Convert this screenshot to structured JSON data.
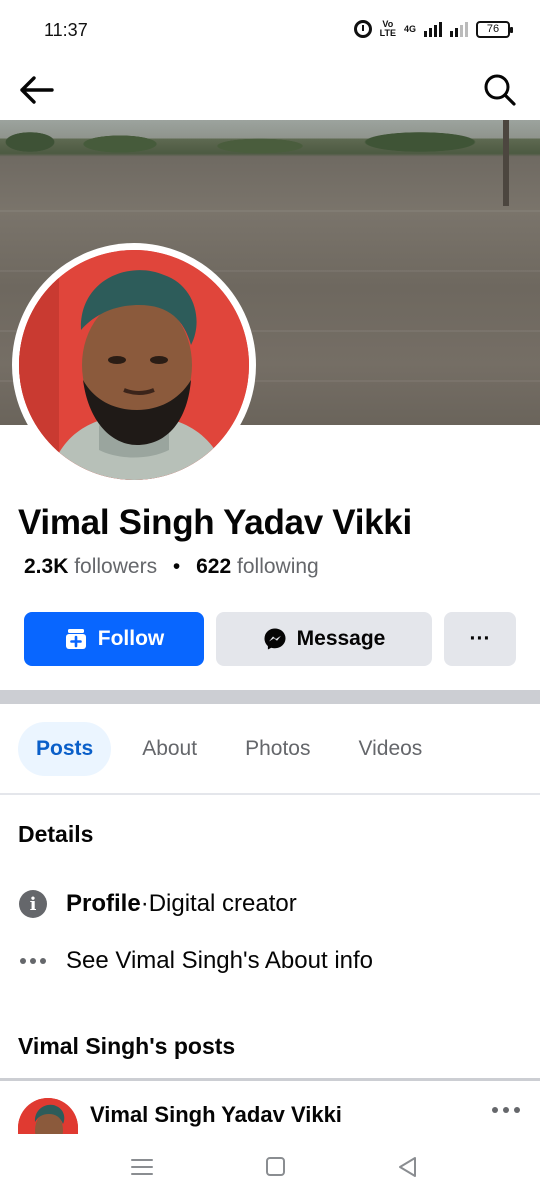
{
  "status_bar": {
    "time": "11:37",
    "volte_line1": "Vo",
    "volte_line2": "LTE",
    "network": "4G",
    "battery": "76"
  },
  "nav": {
    "back_icon": "arrow-left-icon",
    "search_icon": "search-icon"
  },
  "profile": {
    "name": "Vimal Singh Yadav Vikki",
    "followers_count": "2.3K",
    "followers_label": "followers",
    "separator": "•",
    "following_count": "622",
    "following_label": "following"
  },
  "actions": {
    "follow_label": "Follow",
    "message_label": "Message",
    "more_label": "···",
    "follow_color": "#0866ff"
  },
  "tabs": [
    {
      "label": "Posts",
      "active": true
    },
    {
      "label": "About",
      "active": false
    },
    {
      "label": "Photos",
      "active": false
    },
    {
      "label": "Videos",
      "active": false
    }
  ],
  "details": {
    "title": "Details",
    "profile_label": "Profile",
    "profile_sep": " · ",
    "profile_value": "Digital creator",
    "about_link": "See Vimal Singh's About info"
  },
  "posts": {
    "title": "Vimal Singh's posts",
    "first_post_author": "Vimal Singh Yadav Vikki"
  },
  "system_nav": {
    "menu_icon": "menu-lines-icon",
    "home_icon": "square-home-icon",
    "back_icon": "triangle-back-icon"
  }
}
